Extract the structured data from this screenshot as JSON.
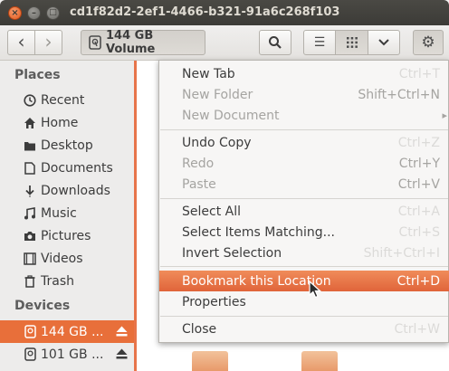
{
  "window": {
    "title": "cd1f82d2-2ef1-4466-b321-91a6c268f103",
    "close_glyph": "×",
    "min_glyph": "–",
    "max_glyph": "□"
  },
  "toolbar": {
    "back_glyph": "‹",
    "forward_glyph": "›",
    "location_label": "144 GB Volume",
    "list_glyph": "☰",
    "dropdown_glyph": "⌄",
    "settings_glyph": "⚙"
  },
  "sidebar": {
    "places_heading": "Places",
    "places": [
      {
        "label": "Recent",
        "icon": "clock-icon"
      },
      {
        "label": "Home",
        "icon": "home-icon"
      },
      {
        "label": "Desktop",
        "icon": "desktop-icon"
      },
      {
        "label": "Documents",
        "icon": "document-icon"
      },
      {
        "label": "Downloads",
        "icon": "download-icon"
      },
      {
        "label": "Music",
        "icon": "music-icon"
      },
      {
        "label": "Pictures",
        "icon": "camera-icon"
      },
      {
        "label": "Videos",
        "icon": "video-icon"
      },
      {
        "label": "Trash",
        "icon": "trash-icon"
      }
    ],
    "devices_heading": "Devices",
    "devices": [
      {
        "label": "144 GB ...",
        "icon": "drive-icon",
        "selected": true
      },
      {
        "label": "101 GB ...",
        "icon": "drive-icon",
        "selected": false
      }
    ],
    "accent_color": "#e86f3a"
  },
  "menu": {
    "items": [
      {
        "label": "New Tab",
        "accel": "Ctrl+T",
        "state": "faint"
      },
      {
        "label": "New Folder",
        "accel": "Shift+Ctrl+N",
        "state": "disabled"
      },
      {
        "label": "New Document",
        "accel": "▸",
        "state": "disabled"
      },
      {
        "label": "Undo Copy",
        "accel": "Ctrl+Z",
        "state": "faint"
      },
      {
        "label": "Redo",
        "accel": "Ctrl+Y",
        "state": "disabled"
      },
      {
        "label": "Paste",
        "accel": "Ctrl+V",
        "state": "disabled"
      },
      {
        "label": "Select All",
        "accel": "Ctrl+A",
        "state": "faint"
      },
      {
        "label": "Select Items Matching...",
        "accel": "Ctrl+S",
        "state": "faint"
      },
      {
        "label": "Invert Selection",
        "accel": "Shift+Ctrl+I",
        "state": "faint"
      },
      {
        "label": "Bookmark this Location",
        "accel": "Ctrl+D",
        "state": "highlighted"
      },
      {
        "label": "Properties",
        "accel": "",
        "state": "normal"
      },
      {
        "label": "Close",
        "accel": "Ctrl+W",
        "state": "faint"
      }
    ],
    "highlight_color": "#e86f3a"
  }
}
